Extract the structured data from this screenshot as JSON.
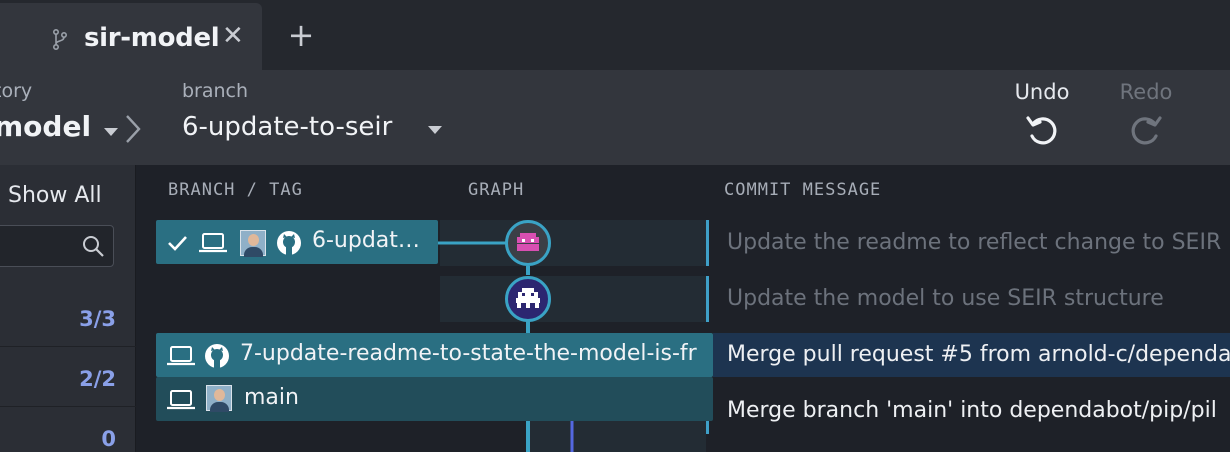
{
  "tab": {
    "title": "sir-model",
    "close_glyph": "✕",
    "new_tab_glyph": "+"
  },
  "toolbar": {
    "repo_caption": "tory",
    "repo_name": "model",
    "branch_caption": "branch",
    "branch_name": "6-update-to-seir",
    "undo_label": "Undo",
    "redo_label": "Redo"
  },
  "left_panel": {
    "show_all_label": "Show All",
    "counts": [
      "3/3",
      "2/2",
      "0"
    ]
  },
  "columns": {
    "branch_tag": "BRANCH / TAG",
    "graph": "GRAPH",
    "commit_message": "COMMIT MESSAGE"
  },
  "refs": [
    {
      "label": "6-updat…",
      "icons": [
        "check-icon",
        "laptop-icon",
        "avatar",
        "github-icon"
      ]
    },
    {
      "label": "7-update-readme-to-state-the-model-is-fr",
      "icons": [
        "laptop-icon",
        "github-icon"
      ]
    },
    {
      "label": "main",
      "icons": [
        "laptop-icon",
        "avatar"
      ]
    }
  ],
  "commits": [
    {
      "message": "Update the readme to reflect change to SEIR"
    },
    {
      "message": "Update the model to use SEIR structure"
    },
    {
      "message": "Merge pull request #5 from arnold-c/dependa"
    },
    {
      "message": "Merge branch 'main' into dependabot/pip/pil"
    }
  ],
  "colors": {
    "accent": "#3aa3c5",
    "pill": "#2a6f82",
    "selected_row": "#1d3450",
    "count": "#8aa0e8"
  }
}
